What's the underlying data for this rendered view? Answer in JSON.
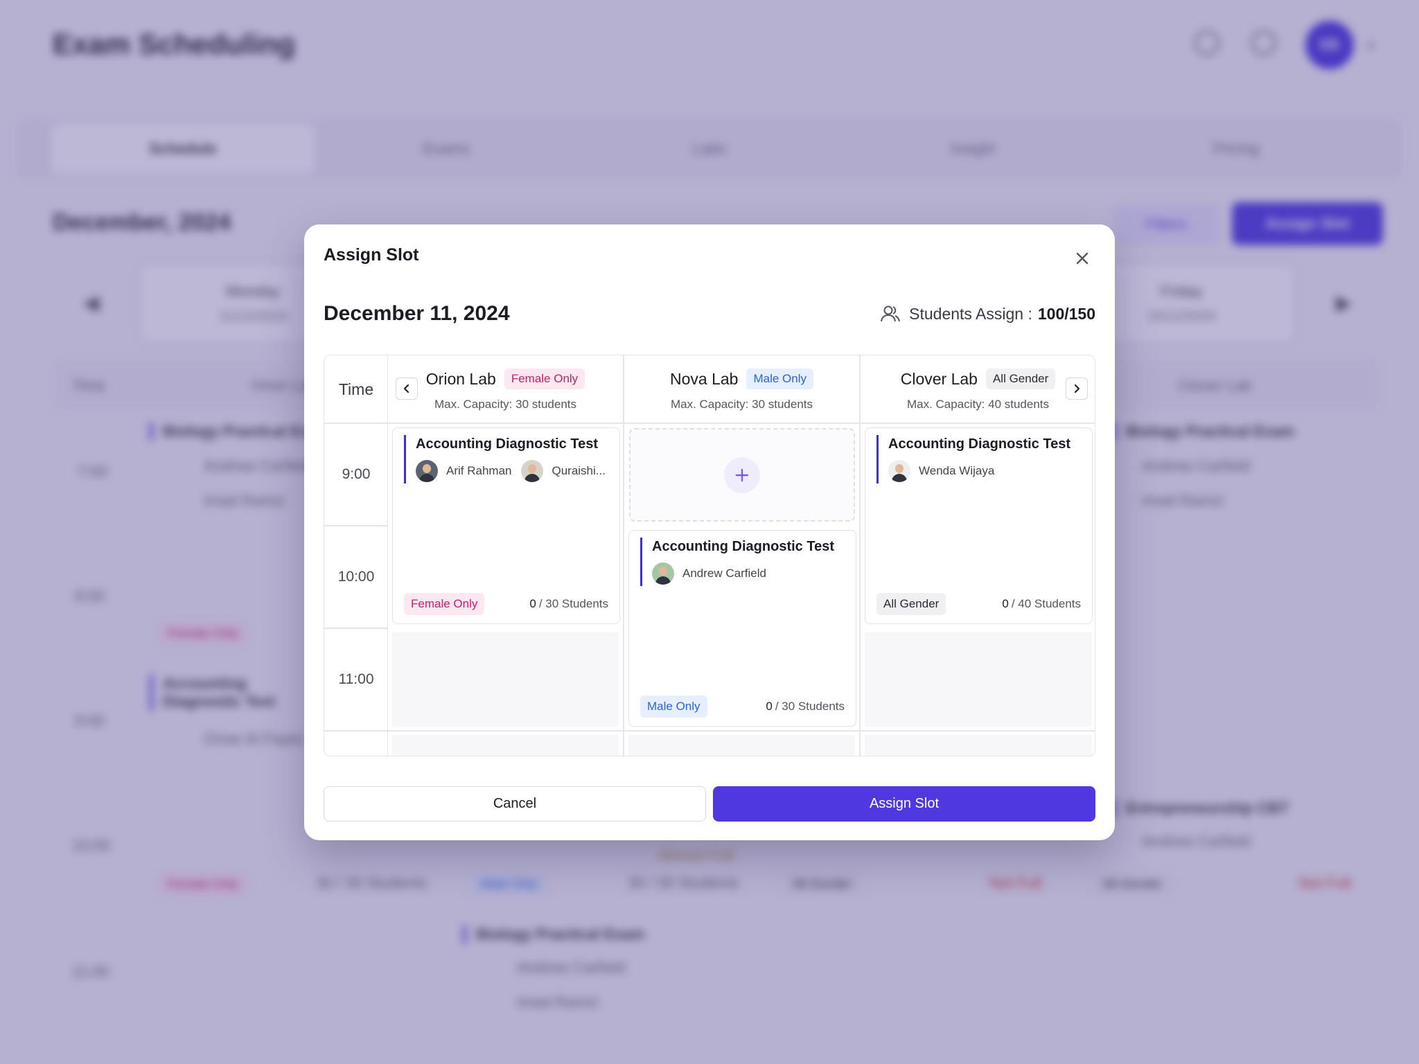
{
  "background": {
    "app_title": "Exam Scheduling",
    "avatar_initials": "EB",
    "tabs": [
      "Schedule",
      "Exams",
      "Labs",
      "Insight",
      "Pricing"
    ],
    "month": "December, 2024",
    "filters_label": "Filters",
    "assign_slot_label": "Assign Slot",
    "days": [
      {
        "name": "Monday",
        "date": "11/12/2024"
      },
      {
        "name": "Friday",
        "date": "15/12/2024"
      }
    ],
    "grid_time_label": "Time",
    "grid_lab_left": "Orion Lab",
    "grid_lab_right": "Clover Lab",
    "times": [
      "7:00",
      "8:00",
      "9:00",
      "10:00",
      "11:00"
    ],
    "events": {
      "biology": "Biology Practical Exam",
      "accounting": "Accounting Diagnostic Test",
      "entrepreneurship": "Entrepreneurship CBT",
      "p1": "Andrew Carfield",
      "p2": "Imad Ramzi",
      "p3": "Omar Al Fayez"
    },
    "pills": {
      "female": "Female Only",
      "male": "Male Only",
      "all": "All Gender",
      "students": "30 / 30 Students",
      "almost": "Almost Full",
      "full": "Not Full"
    }
  },
  "modal": {
    "title": "Assign Slot",
    "date": "December 11, 2024",
    "students_label": "Students Assign :",
    "students_value": "100/150",
    "time_header": "Time",
    "times": [
      "9:00",
      "10:00",
      "11:00"
    ],
    "labs": [
      {
        "name": "Orion Lab",
        "badge": "Female Only",
        "capacity": "Max. Capacity: 30 students"
      },
      {
        "name": "Nova Lab",
        "badge": "Male Only",
        "capacity": "Max. Capacity: 30 students"
      },
      {
        "name": "Clover Lab",
        "badge": "All Gender",
        "capacity": "Max. Capacity: 40 students"
      }
    ],
    "cards": [
      {
        "title": "Accounting Diagnostic Test",
        "proctors": [
          "Arif Rahman",
          "Quraishi..."
        ],
        "gender": "Female Only",
        "count": "0",
        "capacity": "/ 30 Students"
      },
      {
        "title": "Accounting Diagnostic Test",
        "proctors": [
          "Andrew Carfield"
        ],
        "gender": "Male Only",
        "count": "0",
        "capacity": "/ 30 Students"
      },
      {
        "title": "Accounting Diagnostic Test",
        "proctors": [
          "Wenda Wijaya"
        ],
        "gender": "All Gender",
        "count": "0",
        "capacity": "/ 40 Students"
      }
    ],
    "cancel_label": "Cancel",
    "assign_label": "Assign Slot"
  },
  "colors": {
    "accent": "#5038e0",
    "female": "#c1226a",
    "male": "#2a64d8",
    "overlay": "#483a8c"
  }
}
